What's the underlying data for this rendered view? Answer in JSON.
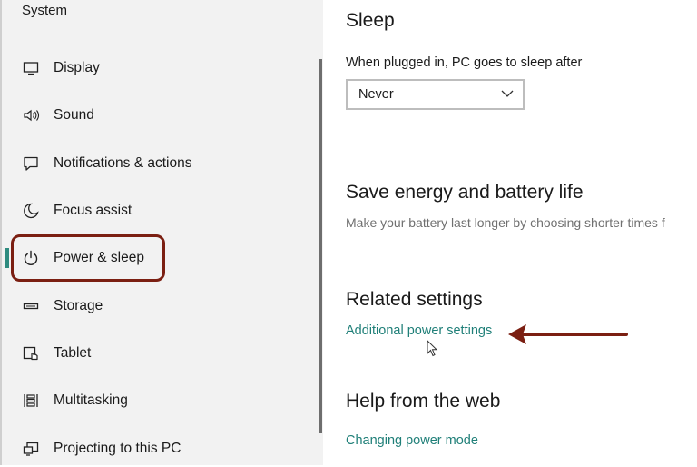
{
  "sidebar": {
    "title": "System",
    "items": [
      {
        "label": "Display",
        "icon": "display-icon"
      },
      {
        "label": "Sound",
        "icon": "speaker-icon"
      },
      {
        "label": "Notifications & actions",
        "icon": "notification-icon"
      },
      {
        "label": "Focus assist",
        "icon": "moon-icon"
      },
      {
        "label": "Power & sleep",
        "icon": "power-icon",
        "selected": true
      },
      {
        "label": "Storage",
        "icon": "storage-icon"
      },
      {
        "label": "Tablet",
        "icon": "tablet-icon"
      },
      {
        "label": "Multitasking",
        "icon": "multitasking-icon"
      },
      {
        "label": "Projecting to this PC",
        "icon": "projecting-icon"
      }
    ]
  },
  "main": {
    "sleep": {
      "heading": "Sleep",
      "plugged_in_label": "When plugged in, PC goes to sleep after",
      "plugged_in_value": "Never"
    },
    "save_energy": {
      "heading": "Save energy and battery life",
      "description": "Make your battery last longer by choosing shorter times f"
    },
    "related": {
      "heading": "Related settings",
      "link": "Additional power settings"
    },
    "help": {
      "heading": "Help from the web",
      "link": "Changing power mode"
    }
  },
  "colors": {
    "accent": "#2e8b7f",
    "link": "#1f7f78",
    "annotation": "#7b1f12",
    "sidebar_bg": "#f2f2f2"
  }
}
